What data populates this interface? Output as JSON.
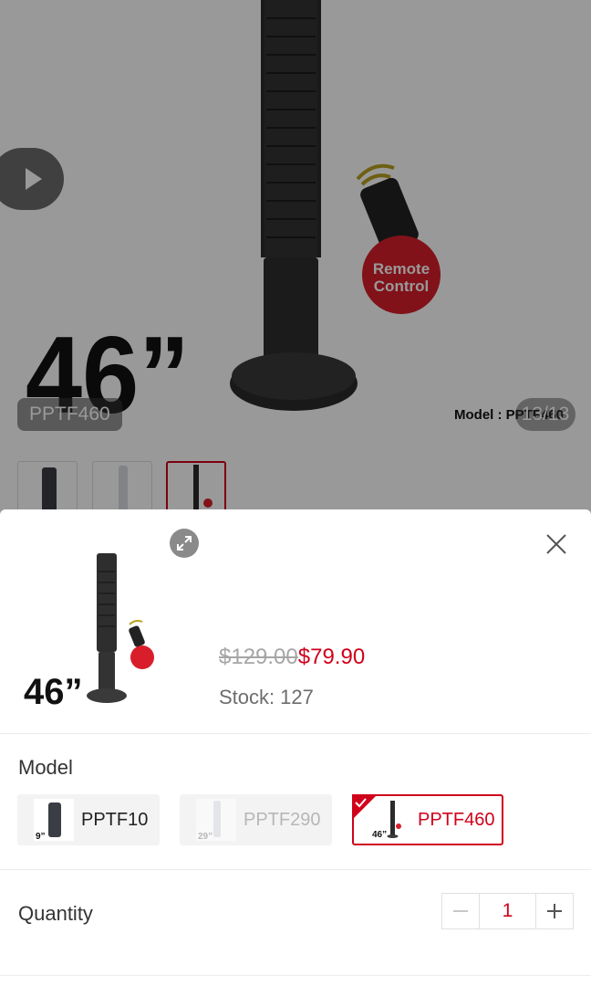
{
  "hero": {
    "badge_size": "46”",
    "remote_line1": "Remote",
    "remote_line2": "Control",
    "model_caption": "Model : PPTF460",
    "variant_tag": "PPTF460",
    "image_counter": "13/13"
  },
  "thumbnails": [
    {
      "name": "thumb-pptf10",
      "active": false
    },
    {
      "name": "thumb-pptf290",
      "active": false
    },
    {
      "name": "thumb-pptf460",
      "active": true
    }
  ],
  "sheet": {
    "image_size_text": "46”",
    "price_original": "$129.00",
    "price_current": "$79.90",
    "stock_label": "Stock:",
    "stock_value": "127",
    "model_title": "Model",
    "options": [
      {
        "label": "PPTF10",
        "size_text": "9”",
        "state": "available"
      },
      {
        "label": "PPTF290",
        "size_text": "29”",
        "state": "disabled"
      },
      {
        "label": "PPTF460",
        "size_text": "46”",
        "state": "selected"
      }
    ],
    "quantity_title": "Quantity",
    "quantity_value": "1"
  },
  "icons": {
    "play": "play-icon",
    "zoom": "expand-icon",
    "close": "close-icon",
    "minus": "minus-icon",
    "plus": "plus-icon",
    "check": "check-icon"
  },
  "colors": {
    "accent": "#d0011b",
    "overlay": "rgba(0,0,0,0.4)",
    "muted_text": "#a6a6a6"
  }
}
